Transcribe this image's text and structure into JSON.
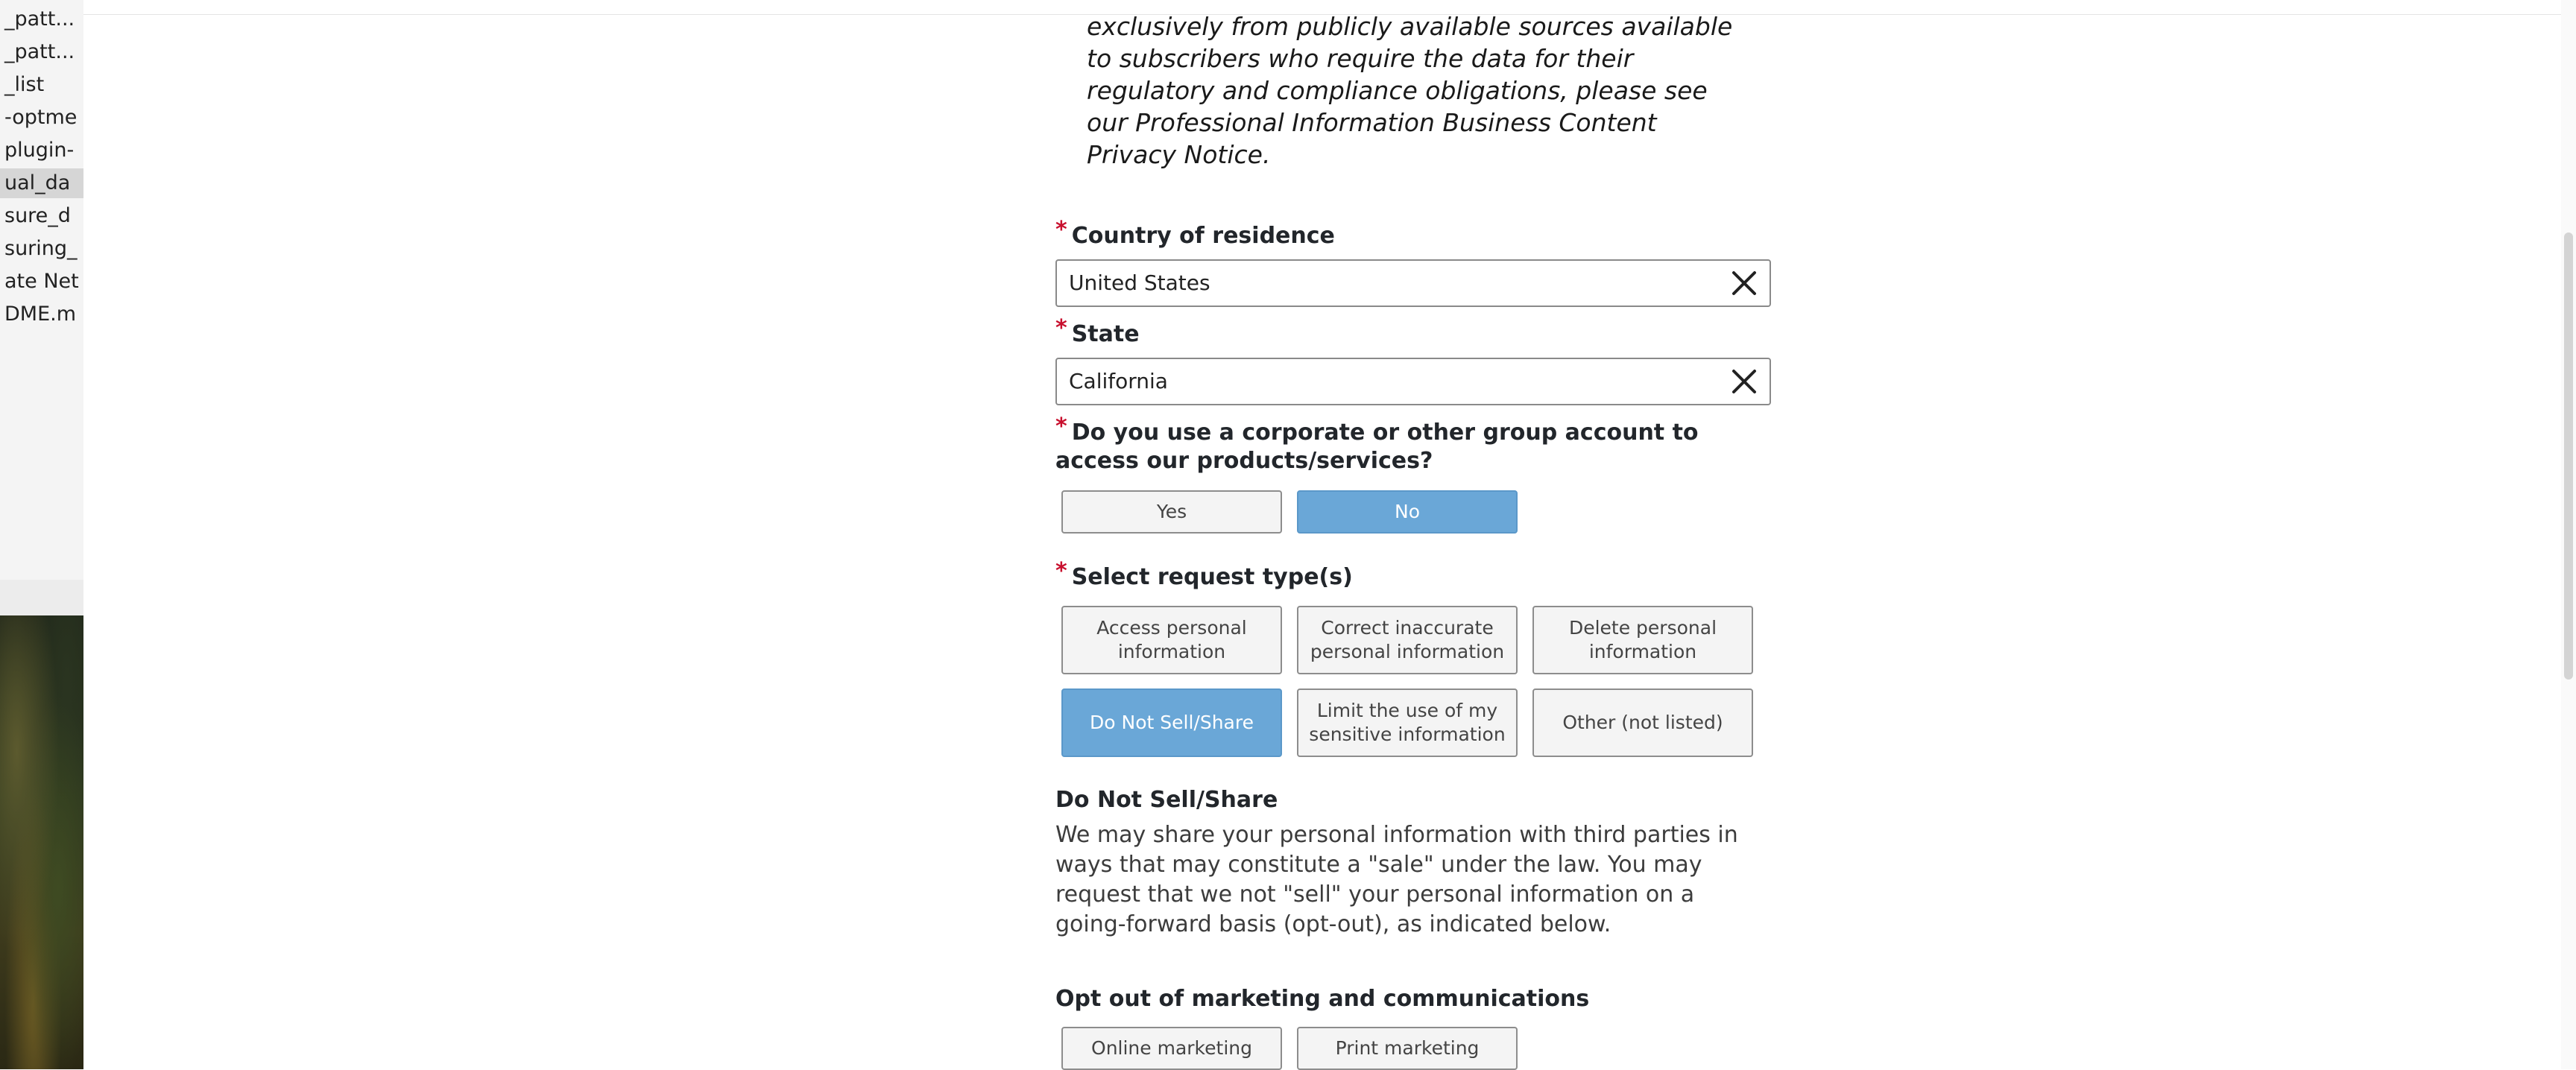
{
  "background_window": {
    "files": [
      "_patt...",
      "_patt...",
      "_list",
      "-optme",
      "plugin-",
      "ual_da",
      "sure_d",
      "suring_",
      "ate Net",
      "DME.m"
    ]
  },
  "form": {
    "intro_text": "exclusively from publicly available sources available to subscribers who require the data for their regulatory and compliance obligations, please see our Professional Information Business Content Privacy Notice.",
    "required_mark": "*",
    "country": {
      "label": "Country of residence",
      "value": "United States"
    },
    "state": {
      "label": "State",
      "value": "California"
    },
    "group_account": {
      "label": "Do you use a corporate or other group account to access our products/services?",
      "yes": "Yes",
      "no": "No",
      "selected": "No"
    },
    "request_types": {
      "label": "Select request type(s)",
      "options": [
        "Access personal information",
        "Correct inaccurate personal information",
        "Delete personal information",
        "Do Not Sell/Share",
        "Limit the use of my sensitive information",
        "Other (not listed)"
      ],
      "selected": "Do Not Sell/Share"
    },
    "do_not_sell": {
      "heading": "Do Not Sell/Share",
      "text": "We may share your personal information with third parties in ways that may constitute a \"sale\" under the law. You may request that we not \"sell\" your personal information on a going-forward basis (opt-out), as indicated below."
    },
    "opt_out": {
      "heading": "Opt out of marketing and communications",
      "options": [
        "Online marketing",
        "Print marketing"
      ]
    }
  },
  "colors": {
    "accent": "#6aa7d7",
    "required": "#c8102e"
  }
}
